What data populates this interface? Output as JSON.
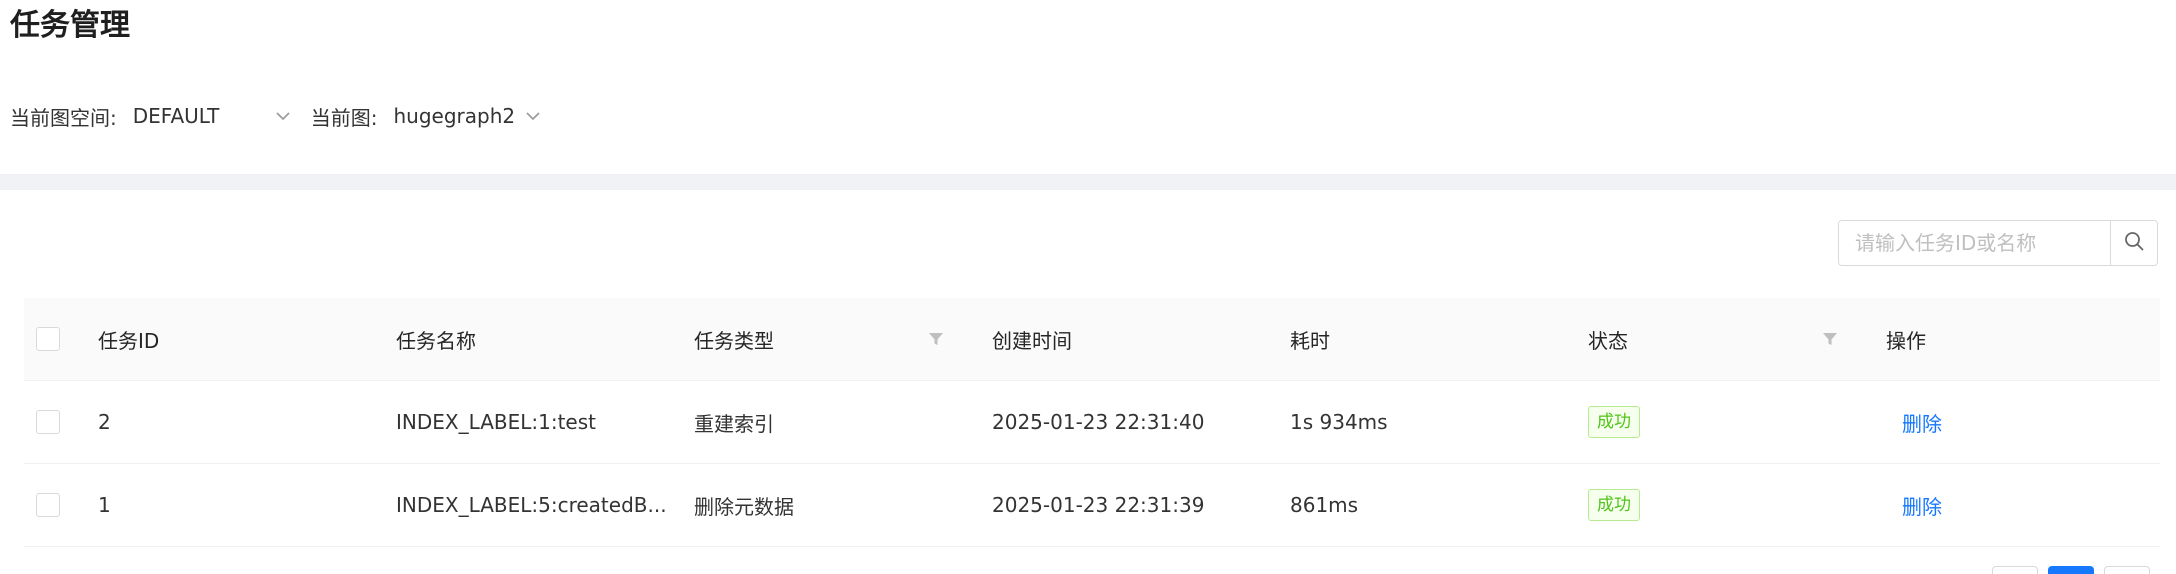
{
  "page": {
    "title": "任务管理"
  },
  "selectors": {
    "graphspace_label": "当前图空间:",
    "graphspace_value": "DEFAULT",
    "graph_label": "当前图:",
    "graph_value": "hugegraph2"
  },
  "search": {
    "placeholder": "请输入任务ID或名称",
    "value": ""
  },
  "table": {
    "columns": {
      "id": "任务ID",
      "name": "任务名称",
      "type": "任务类型",
      "created": "创建时间",
      "duration": "耗时",
      "status": "状态",
      "action": "操作"
    },
    "rows": [
      {
        "id": "2",
        "name": "INDEX_LABEL:1:test",
        "type": "重建索引",
        "created": "2025-01-23 22:31:40",
        "duration": "1s 934ms",
        "status": "成功",
        "action": "删除"
      },
      {
        "id": "1",
        "name": "INDEX_LABEL:5:createdB...",
        "type": "删除元数据",
        "created": "2025-01-23 22:31:39",
        "duration": "861ms",
        "status": "成功",
        "action": "删除"
      }
    ]
  },
  "colors": {
    "accent": "#1677ff",
    "success": "#52c41a",
    "band": "#f0f2f5",
    "header_bg": "#fafafa"
  },
  "icons": {
    "search": "search-icon",
    "filter": "filter-icon",
    "dropdown": "chevron-down-icon"
  }
}
